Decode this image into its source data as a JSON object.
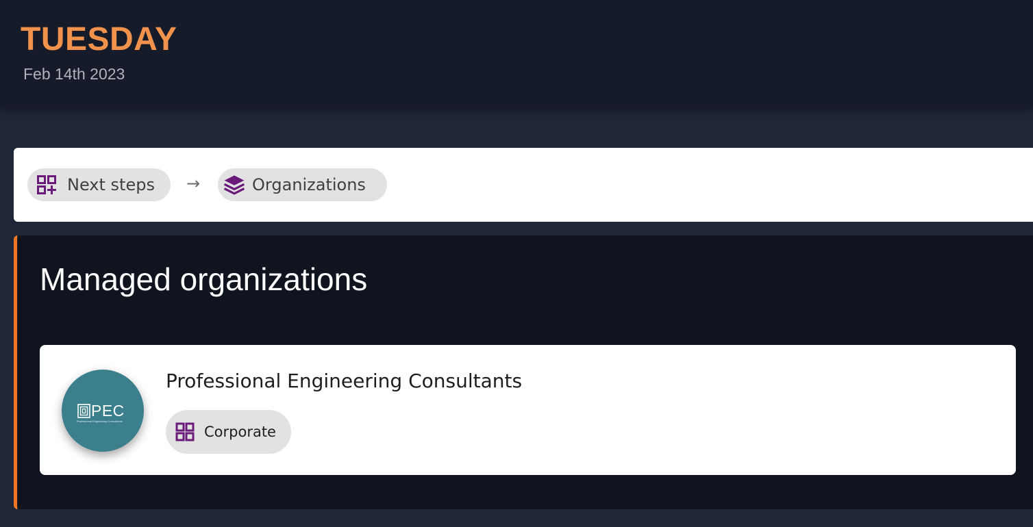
{
  "header": {
    "day": "TUESDAY",
    "date": "Feb 14th 2023"
  },
  "breadcrumb": {
    "items": [
      {
        "label": "Next steps",
        "icon": "grid-add-icon"
      },
      {
        "label": "Organizations",
        "icon": "layers-icon"
      }
    ],
    "separator": "→"
  },
  "panel": {
    "title": "Managed organizations",
    "organizations": [
      {
        "name": "Professional Engineering Consultants",
        "logo_text": "PEC",
        "logo_subtext": "Professional Engineering Consultants",
        "tag": {
          "label": "Corporate",
          "icon": "grid-icon"
        }
      }
    ]
  },
  "colors": {
    "accent_orange": "#f0924b",
    "panel_border": "#ee7624",
    "icon_purple": "#6a1b7a",
    "logo_teal": "#3a7f8b"
  }
}
